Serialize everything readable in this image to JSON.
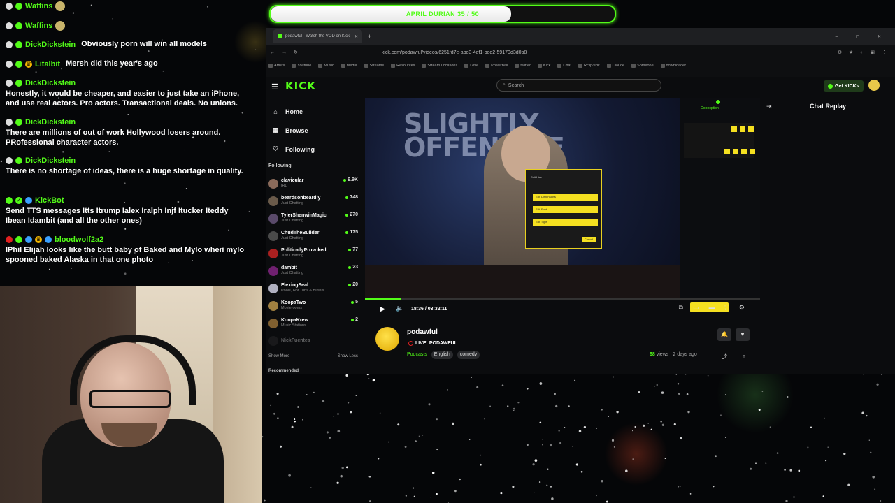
{
  "chat": [
    {
      "user": "Waffins",
      "text": ""
    },
    {
      "user": "Waffins",
      "text": ""
    },
    {
      "user": "DickDickstein",
      "text": "Obviously porn will win all models"
    },
    {
      "user": "Litalbit",
      "text": "Mersh did this year's ago"
    },
    {
      "user": "DickDickstein",
      "text": "Honestly, it would be cheaper, and easier to just take an iPhone, and use real actors. Pro actors. Transactional deals. No unions."
    },
    {
      "user": "DickDickstein",
      "text": "There are millions of out of work Hollywood losers around. PRofessional character actors."
    },
    {
      "user": "DickDickstein",
      "text": "There is no shortage of ideas, there is a huge shortage in quality."
    },
    {
      "user": "KickBot",
      "text": "Send TTS messages Itts Itrump Ialex Iralph Injf Itucker Iteddy Ibean Idambit (and all the other ones)"
    },
    {
      "user": "bloodwolf2a2",
      "text": "IPhil Elijah looks like the butt baby of Baked and Mylo when mylo spooned baked Alaska in that one photo"
    }
  ],
  "goal": {
    "label": "APRIL DURIAN 35 / 50",
    "progress": 0.7
  },
  "browser": {
    "tab_title": "podawful - Watch the VOD on Kick",
    "url": "kick.com/podawful/videos/6251fd7e-abe3-4ef1-bee2-59170d3d0b8",
    "bookmarks": [
      "Artists",
      "Youtube",
      "Music",
      "Media",
      "Streams",
      "Resources",
      "Stream Locations",
      "Love",
      "Powerball",
      "twitter",
      "Kick",
      "Chat",
      "Rclip/edit",
      "Claude",
      "Someone",
      "downloader"
    ]
  },
  "site": {
    "logo": "KICK",
    "search_placeholder": "Search",
    "get_kicks": "Get KICKs",
    "nav": [
      {
        "icon": "home-icon",
        "glyph": "⌂",
        "label": "Home"
      },
      {
        "icon": "browse-icon",
        "glyph": "▦",
        "label": "Browse"
      },
      {
        "icon": "heart-icon",
        "glyph": "♡",
        "label": "Following"
      }
    ],
    "following_heading": "Following",
    "following": [
      {
        "name": "clavicular",
        "sub": "IRL",
        "count": "9.9K",
        "color": "#8a6a5a"
      },
      {
        "name": "beardsonbeardly",
        "sub": "Just Chatting",
        "count": "748",
        "color": "#6a5a4a"
      },
      {
        "name": "TylerShenwinMagic",
        "sub": "Just Chatting",
        "count": "270",
        "color": "#5a4a6a"
      },
      {
        "name": "ChudTheBuilder",
        "sub": "Just Chatting",
        "count": "175",
        "color": "#4a4a4a"
      },
      {
        "name": "PoliticallyProvoked",
        "sub": "Just Chatting",
        "count": "77",
        "color": "#aa2020"
      },
      {
        "name": "dambit",
        "sub": "Just Chatting",
        "count": "23",
        "color": "#702070"
      },
      {
        "name": "FlexingSeal",
        "sub": "Pools, Hot Tubs & Bikinis",
        "count": "20",
        "color": "#b0b0c0"
      },
      {
        "name": "KoopaTwo",
        "sub": "Movierooms",
        "count": "5",
        "color": "#a08040"
      },
      {
        "name": "KoopaKrew",
        "sub": "Music Stations",
        "count": "2",
        "color": "#806030"
      },
      {
        "name": "NickFuentes",
        "sub": "",
        "count": "",
        "color": "#333"
      }
    ],
    "show_more": "Show More",
    "show_less": "Show Less",
    "recommended": "Recommended",
    "player": {
      "stage_text": "SLIGHTLY OFFENSIVE",
      "time": "18:36 / 03:32:11",
      "played_fraction": 0.09,
      "modal_title": "Edit Hide",
      "modal_buttons": [
        "Edit Dimensions",
        "Edit Font",
        "Edit Type"
      ],
      "modal_cancel": "Cancel",
      "panel_title": "Goonoption"
    },
    "channel": {
      "name": "podawful",
      "live_label": "LIVE: PODAWFUL",
      "category": "Podcasts",
      "tags": [
        "English",
        "comedy"
      ],
      "views_count": "68",
      "views_label": "views",
      "age": "2 days ago"
    },
    "chat_replay": "Chat Replay"
  }
}
